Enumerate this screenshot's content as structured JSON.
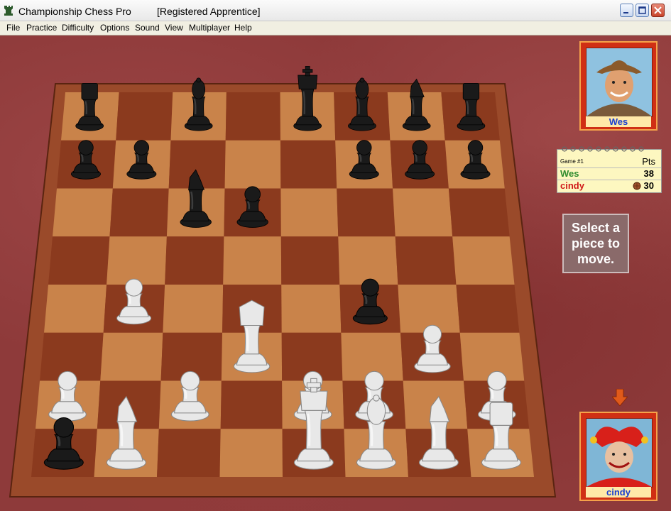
{
  "window": {
    "title": "Championship Chess Pro",
    "subtitle": "[Registered Apprentice]"
  },
  "menu": [
    "File",
    "Practice",
    "Difficulty",
    "Options",
    "Sound",
    "View",
    "Multiplayer",
    "Help"
  ],
  "players": {
    "top": {
      "name": "Wes"
    },
    "bottom": {
      "name": "cindy"
    }
  },
  "scorecard": {
    "game_label": "Game #1",
    "pts_label": "Pts",
    "rows": [
      {
        "name": "Wes",
        "points": "38",
        "color": "#2e8b2e"
      },
      {
        "name": "cindy",
        "points": "30",
        "color": "#d01818"
      }
    ]
  },
  "status_message": "Select a piece to move.",
  "board": {
    "light_color": "#c9834a",
    "dark_color": "#8b3a1e",
    "frame_color": "#9a4a2a",
    "pieces": [
      {
        "side": "black",
        "type": "rook",
        "file": 0,
        "rank": 7
      },
      {
        "side": "black",
        "type": "bishop",
        "file": 2,
        "rank": 7
      },
      {
        "side": "black",
        "type": "king",
        "file": 4,
        "rank": 7
      },
      {
        "side": "black",
        "type": "bishop",
        "file": 5,
        "rank": 7
      },
      {
        "side": "black",
        "type": "knight",
        "file": 6,
        "rank": 7
      },
      {
        "side": "black",
        "type": "rook",
        "file": 7,
        "rank": 7
      },
      {
        "side": "black",
        "type": "pawn",
        "file": 0,
        "rank": 6
      },
      {
        "side": "black",
        "type": "pawn",
        "file": 1,
        "rank": 6
      },
      {
        "side": "black",
        "type": "pawn",
        "file": 5,
        "rank": 6
      },
      {
        "side": "black",
        "type": "pawn",
        "file": 6,
        "rank": 6
      },
      {
        "side": "black",
        "type": "pawn",
        "file": 7,
        "rank": 6
      },
      {
        "side": "black",
        "type": "knight",
        "file": 2,
        "rank": 5
      },
      {
        "side": "black",
        "type": "pawn",
        "file": 3,
        "rank": 5
      },
      {
        "side": "black",
        "type": "pawn",
        "file": 5,
        "rank": 3
      },
      {
        "side": "black",
        "type": "pawn",
        "file": 0,
        "rank": 0
      },
      {
        "side": "white",
        "type": "pawn",
        "file": 1,
        "rank": 3
      },
      {
        "side": "white",
        "type": "queen",
        "file": 3,
        "rank": 2
      },
      {
        "side": "white",
        "type": "pawn",
        "file": 6,
        "rank": 2
      },
      {
        "side": "white",
        "type": "pawn",
        "file": 0,
        "rank": 1
      },
      {
        "side": "white",
        "type": "pawn",
        "file": 2,
        "rank": 1
      },
      {
        "side": "white",
        "type": "pawn",
        "file": 4,
        "rank": 1
      },
      {
        "side": "white",
        "type": "pawn",
        "file": 5,
        "rank": 1
      },
      {
        "side": "white",
        "type": "pawn",
        "file": 7,
        "rank": 1
      },
      {
        "side": "white",
        "type": "knight",
        "file": 1,
        "rank": 0
      },
      {
        "side": "white",
        "type": "king",
        "file": 4,
        "rank": 0
      },
      {
        "side": "white",
        "type": "bishop",
        "file": 5,
        "rank": 0
      },
      {
        "side": "white",
        "type": "knight",
        "file": 6,
        "rank": 0
      },
      {
        "side": "white",
        "type": "rook",
        "file": 7,
        "rank": 0
      }
    ]
  },
  "icons": {
    "app": "chess-rook-icon",
    "turn_indicator": "down-arrow-icon",
    "score_marker": "ball-icon"
  }
}
